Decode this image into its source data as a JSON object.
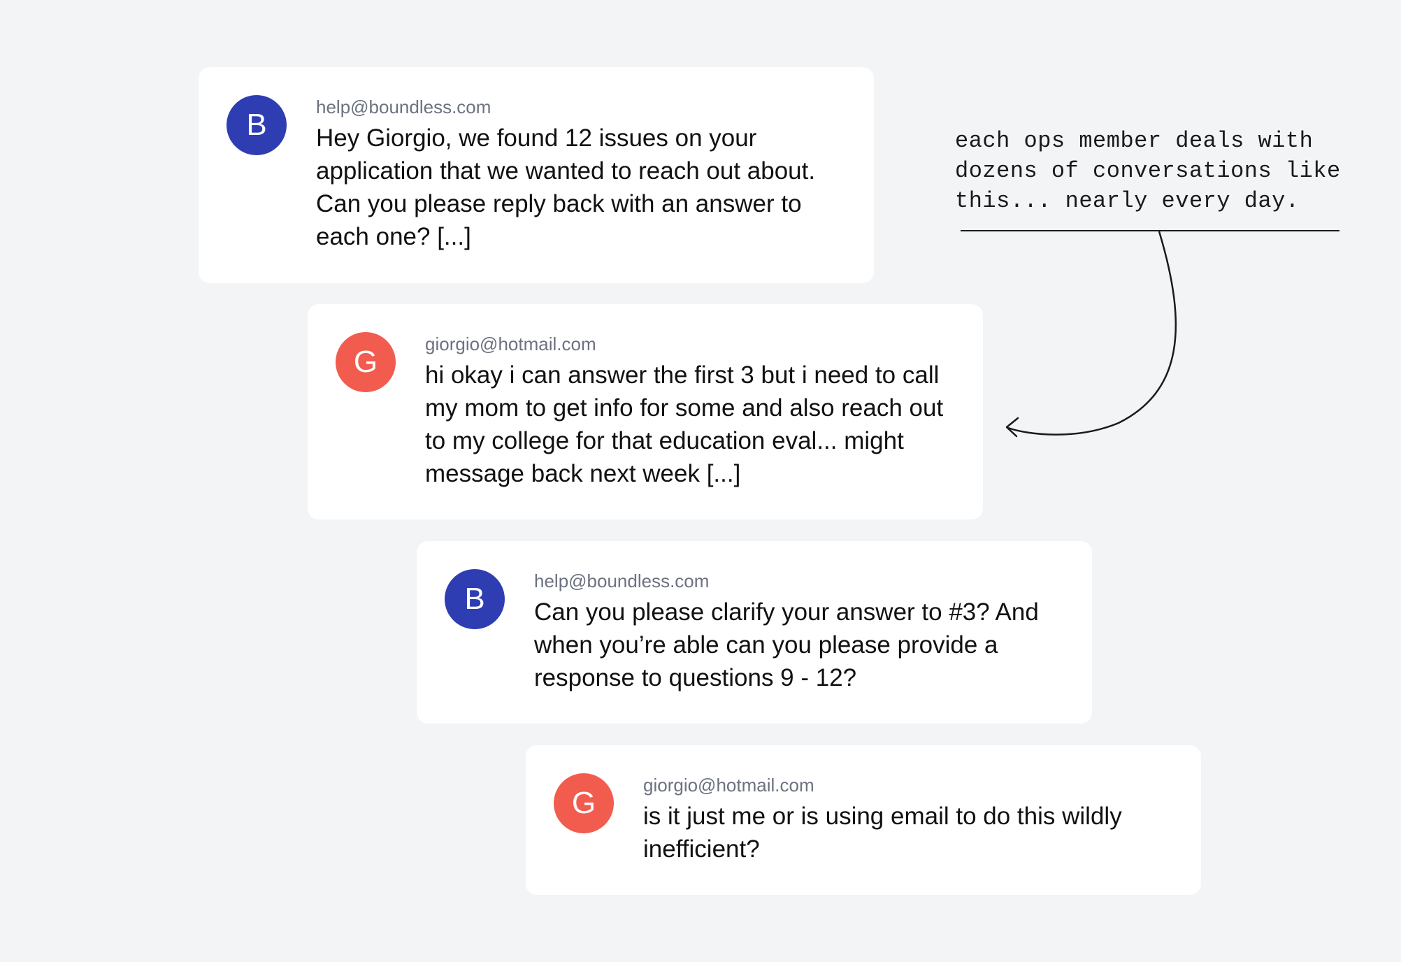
{
  "colors": {
    "background": "#f3f4f6",
    "card": "#ffffff",
    "boundless_avatar": "#2f3db2",
    "giorgio_avatar": "#f25c4f",
    "sender_text": "#6b7280",
    "message_text": "#111111"
  },
  "messages": [
    {
      "avatar_letter": "B",
      "sender": "help@boundless.com",
      "text": "Hey Giorgio, we found 12 issues on your application that we wanted to reach out about. Can you please reply back with an answer to each one? [...]"
    },
    {
      "avatar_letter": "G",
      "sender": "giorgio@hotmail.com",
      "text": "hi okay i can answer the first 3 but i need to call my mom to get info for some and also reach out to my college for that education eval... might message back next week [...]"
    },
    {
      "avatar_letter": "B",
      "sender": "help@boundless.com",
      "text": "Can you please clarify your answer to #3? And when you’re able can you please provide a response to questions 9 - 12?"
    },
    {
      "avatar_letter": "G",
      "sender": "giorgio@hotmail.com",
      "text": "is it just me or is using email to do this wildly inefficient?"
    }
  ],
  "annotation": {
    "lines": [
      "each ops member deals with",
      "dozens of conversations like",
      "this... nearly every day."
    ]
  }
}
